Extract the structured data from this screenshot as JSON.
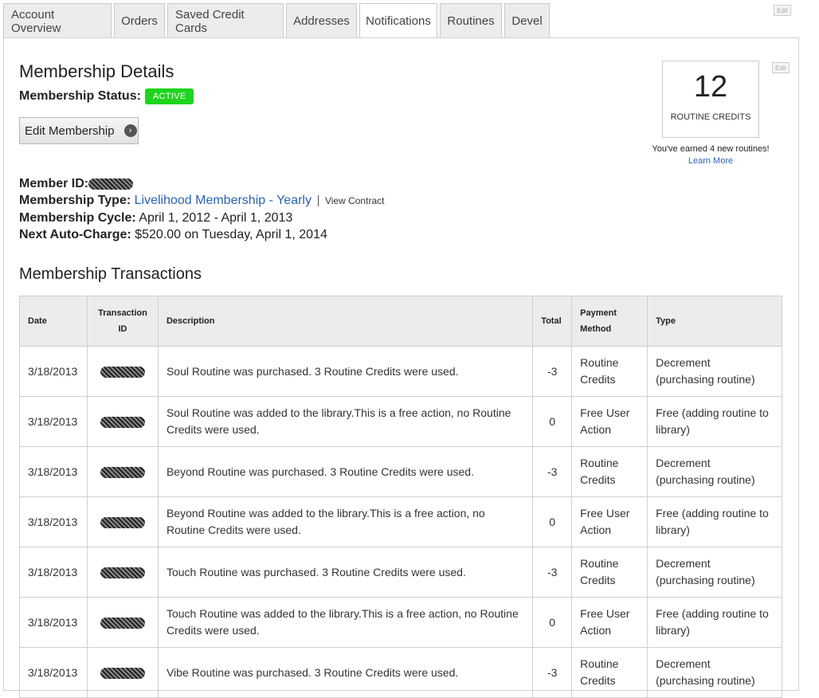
{
  "tabs": [
    {
      "label": "Account Overview"
    },
    {
      "label": "Orders"
    },
    {
      "label": "Saved Credit Cards"
    },
    {
      "label": "Addresses"
    },
    {
      "label": "Notifications"
    },
    {
      "label": "Routines"
    },
    {
      "label": "Devel"
    }
  ],
  "edit_label": "Edit",
  "membership": {
    "title": "Membership Details",
    "status_label": "Membership Status:",
    "status_value": "ACTIVE",
    "edit_button": "Edit Membership",
    "member_id_label": "Member ID:",
    "type_label": "Membership Type:",
    "type_value": "Livelihood Membership - Yearly",
    "view_contract": "View Contract",
    "cycle_label": "Membership Cycle:",
    "cycle_value": "April 1, 2012 - April 1, 2013",
    "autocharge_label": "Next Auto-Charge:",
    "autocharge_value": "$520.00 on Tuesday, April 1, 2014"
  },
  "credits": {
    "count": "12",
    "label": "ROUTINE CREDITS",
    "earned": "You've earned 4 new routines!",
    "learn_more": "Learn More"
  },
  "transactions": {
    "title": "Membership Transactions",
    "headers": {
      "date": "Date",
      "txn_id_1": "Transaction",
      "txn_id_2": "ID",
      "description": "Description",
      "total": "Total",
      "payment_1": "Payment",
      "payment_2": "Method",
      "type": "Type"
    },
    "rows": [
      {
        "date": "3/18/2013",
        "description": "Soul Routine was purchased. 3 Routine Credits were used.",
        "total": "-3",
        "pay1": "Routine",
        "pay2": "Credits",
        "type1": "Decrement",
        "type2": "(purchasing routine)"
      },
      {
        "date": "3/18/2013",
        "description": "Soul Routine was added to the library.This is a free action, no Routine Credits were used.",
        "total": "0",
        "pay1": "Free User",
        "pay2": "Action",
        "type1": "Free (adding routine to",
        "type2": "library)"
      },
      {
        "date": "3/18/2013",
        "description": "Beyond Routine was purchased. 3 Routine Credits were used.",
        "total": "-3",
        "pay1": "Routine",
        "pay2": "Credits",
        "type1": "Decrement",
        "type2": "(purchasing routine)"
      },
      {
        "date": "3/18/2013",
        "description": "Beyond Routine was added to the library.This is a free action, no Routine Credits were used.",
        "total": "0",
        "pay1": "Free User",
        "pay2": "Action",
        "type1": "Free (adding routine to",
        "type2": "library)"
      },
      {
        "date": "3/18/2013",
        "description": "Touch Routine was purchased. 3 Routine Credits were used.",
        "total": "-3",
        "pay1": "Routine",
        "pay2": "Credits",
        "type1": "Decrement",
        "type2": "(purchasing routine)"
      },
      {
        "date": "3/18/2013",
        "description": "Touch Routine was added to the library.This is a free action, no Routine Credits were used.",
        "total": "0",
        "pay1": "Free User",
        "pay2": "Action",
        "type1": "Free (adding routine to",
        "type2": "library)"
      },
      {
        "date": "3/18/2013",
        "description": "Vibe Routine was purchased. 3 Routine Credits were used.",
        "total": "-3",
        "pay1": "Routine",
        "pay2": "Credits",
        "type1": "Decrement",
        "type2": "(purchasing routine)"
      }
    ]
  },
  "colors": {
    "active_badge": "#1ed41e",
    "link": "#2a63b8",
    "header_bg": "#ececec"
  },
  "icons": {
    "edit_chevron": "chevron-right-circle-icon"
  }
}
